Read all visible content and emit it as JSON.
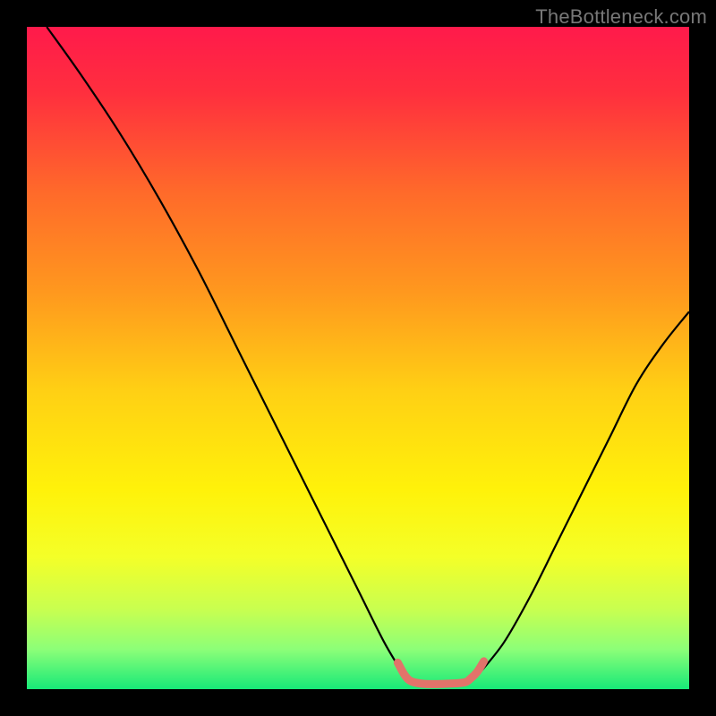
{
  "watermark": {
    "text": "TheBottleneck.com"
  },
  "chart_data": {
    "type": "line",
    "title": "",
    "xlabel": "",
    "ylabel": "",
    "xlim": [
      0,
      100
    ],
    "ylim": [
      0,
      100
    ],
    "grid": false,
    "legend": false,
    "gradient_stops": [
      {
        "t": 0.0,
        "color": "#ff1a4b"
      },
      {
        "t": 0.1,
        "color": "#ff2f3e"
      },
      {
        "t": 0.25,
        "color": "#ff6a2a"
      },
      {
        "t": 0.4,
        "color": "#ff981e"
      },
      {
        "t": 0.55,
        "color": "#ffd014"
      },
      {
        "t": 0.7,
        "color": "#fff20a"
      },
      {
        "t": 0.8,
        "color": "#f4ff28"
      },
      {
        "t": 0.88,
        "color": "#c8ff50"
      },
      {
        "t": 0.94,
        "color": "#8cff78"
      },
      {
        "t": 1.0,
        "color": "#17e978"
      }
    ],
    "series": [
      {
        "name": "left-curve",
        "type": "line",
        "color": "#000000",
        "width": 2.2,
        "x": [
          3,
          8,
          14,
          20,
          26,
          32,
          38,
          44,
          50,
          54,
          57
        ],
        "y": [
          100,
          93,
          84,
          74,
          63,
          51,
          39,
          27,
          15,
          7,
          2
        ]
      },
      {
        "name": "right-curve",
        "type": "line",
        "color": "#000000",
        "width": 2.2,
        "x": [
          68,
          72,
          76,
          80,
          84,
          88,
          92,
          96,
          100
        ],
        "y": [
          2,
          7,
          14,
          22,
          30,
          38,
          46,
          52,
          57
        ]
      },
      {
        "name": "valley-highlight",
        "type": "line",
        "color": "#e2736a",
        "width": 9,
        "cap": "round",
        "x": [
          56,
          57,
          58,
          60,
          63,
          66,
          67,
          68,
          69
        ],
        "y": [
          4.0,
          2.2,
          1.2,
          0.8,
          0.8,
          1.0,
          1.6,
          2.6,
          4.2
        ]
      }
    ]
  }
}
